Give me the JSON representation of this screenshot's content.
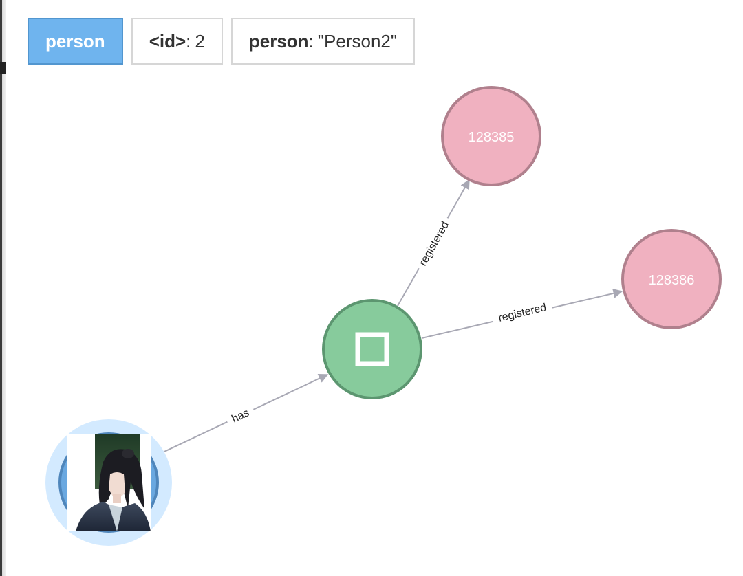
{
  "property_bar": {
    "label": "person",
    "id_key": "<id>",
    "id_value": "2",
    "prop_key": "person",
    "prop_value": "\"Person2\""
  },
  "graph": {
    "nodes": [
      {
        "name": "person",
        "caption": "",
        "color": "#6aa8e0",
        "selected": true,
        "icon": "portrait-image"
      },
      {
        "name": "hub",
        "caption": "",
        "color": "#87cb9c",
        "icon": "square-outline-icon"
      },
      {
        "name": "account-128385",
        "caption": "128385",
        "color": "#f0b1c0"
      },
      {
        "name": "account-128386",
        "caption": "128386",
        "color": "#f0b1c0"
      }
    ],
    "relationships": [
      {
        "from": "person",
        "to": "hub",
        "type": "has"
      },
      {
        "from": "hub",
        "to": "account-128385",
        "type": "registered"
      },
      {
        "from": "hub",
        "to": "account-128386",
        "type": "registered"
      }
    ],
    "colors": {
      "person_selection_halo": "#d3eaff",
      "hub_fill": "#87cb9c",
      "hub_border": "#5c9670",
      "account_fill": "#f0b1c0",
      "account_border": "#b0808d",
      "edge": "#a8a8b4"
    }
  }
}
